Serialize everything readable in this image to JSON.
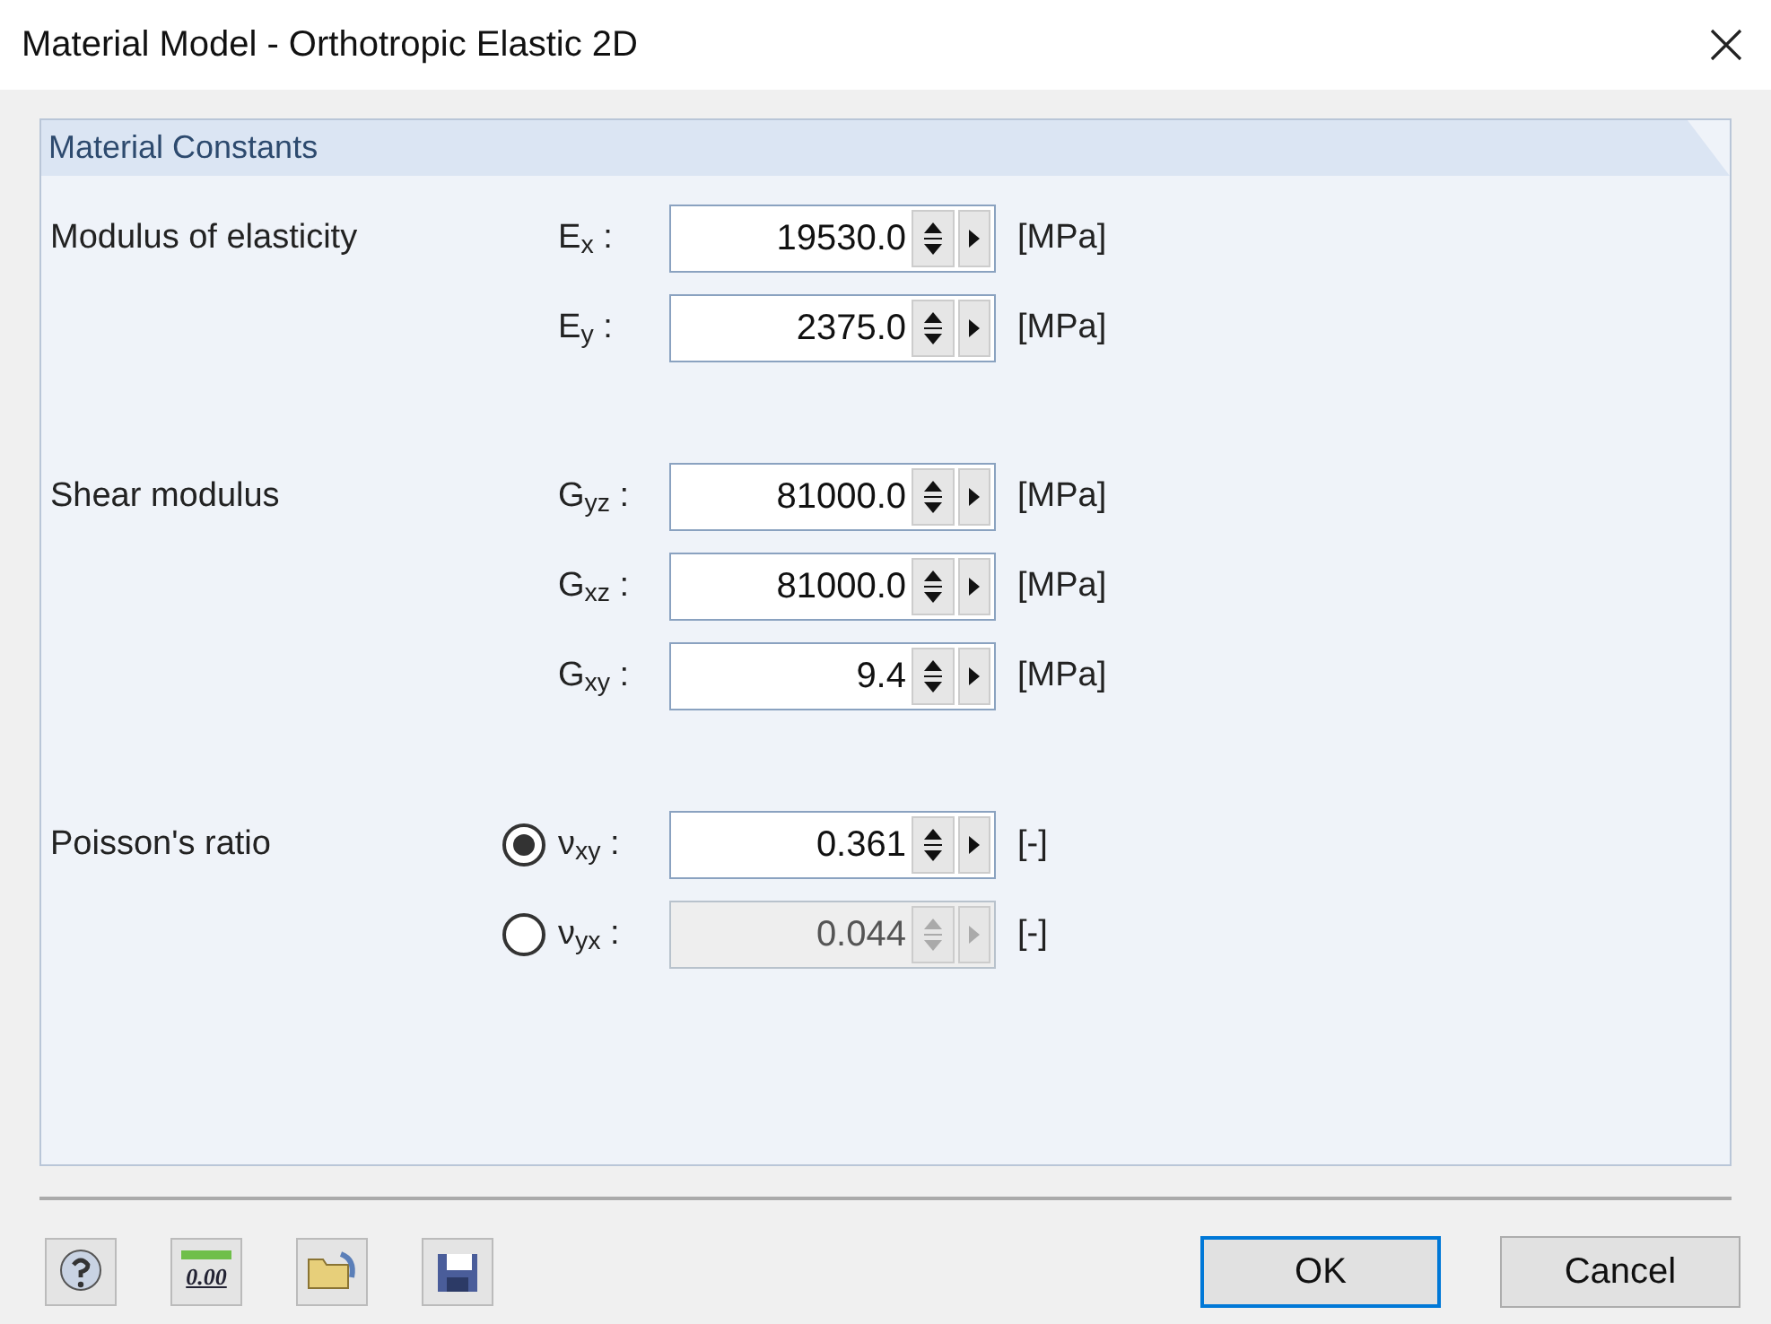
{
  "window": {
    "title": "Material Model - Orthotropic Elastic 2D"
  },
  "section": {
    "title": "Material Constants"
  },
  "groups": [
    {
      "label": "Modulus of elasticity",
      "rows": [
        {
          "kind": "plain",
          "symbol": "E$_{x}$ :",
          "value": "19530.0",
          "unit": "[MPa]",
          "disabled": false
        },
        {
          "kind": "plain",
          "symbol": "E$_{y}$ :",
          "value": "2375.0",
          "unit": "[MPa]",
          "disabled": false
        }
      ]
    },
    {
      "label": "Shear modulus",
      "rows": [
        {
          "kind": "plain",
          "symbol": "G$_{yz}$ :",
          "value": "81000.0",
          "unit": "[MPa]",
          "disabled": false
        },
        {
          "kind": "plain",
          "symbol": "G$_{xz}$ :",
          "value": "81000.0",
          "unit": "[MPa]",
          "disabled": false
        },
        {
          "kind": "plain",
          "symbol": "G$_{xy}$ :",
          "value": "9.4",
          "unit": "[MPa]",
          "disabled": false
        }
      ]
    },
    {
      "label": "Poisson's ratio",
      "rows": [
        {
          "kind": "radio",
          "selected": true,
          "symbol": "ν$_{xy}$ :",
          "value": "0.361",
          "unit": "[-]",
          "disabled": false
        },
        {
          "kind": "radio",
          "selected": false,
          "symbol": "ν$_{yx}$ :",
          "value": "0.044",
          "unit": "[-]",
          "disabled": true
        }
      ]
    }
  ],
  "toolbar": {
    "decimal_icon_text": "0.00"
  },
  "buttons": [
    {
      "label": "OK",
      "default": true
    },
    {
      "label": "Cancel",
      "default": false
    }
  ]
}
